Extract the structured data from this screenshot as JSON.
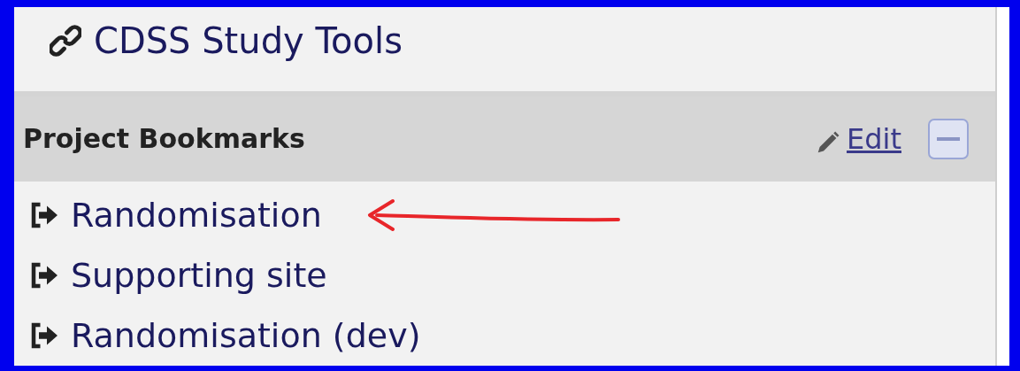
{
  "top_link": {
    "label": "CDSS Study Tools"
  },
  "bookmarks": {
    "title": "Project Bookmarks",
    "edit_label": "Edit",
    "collapsed": false,
    "items": [
      {
        "label": "Randomisation",
        "annotated": true
      },
      {
        "label": "Supporting site",
        "annotated": false
      },
      {
        "label": "Randomisation (dev)",
        "annotated": false
      }
    ]
  }
}
